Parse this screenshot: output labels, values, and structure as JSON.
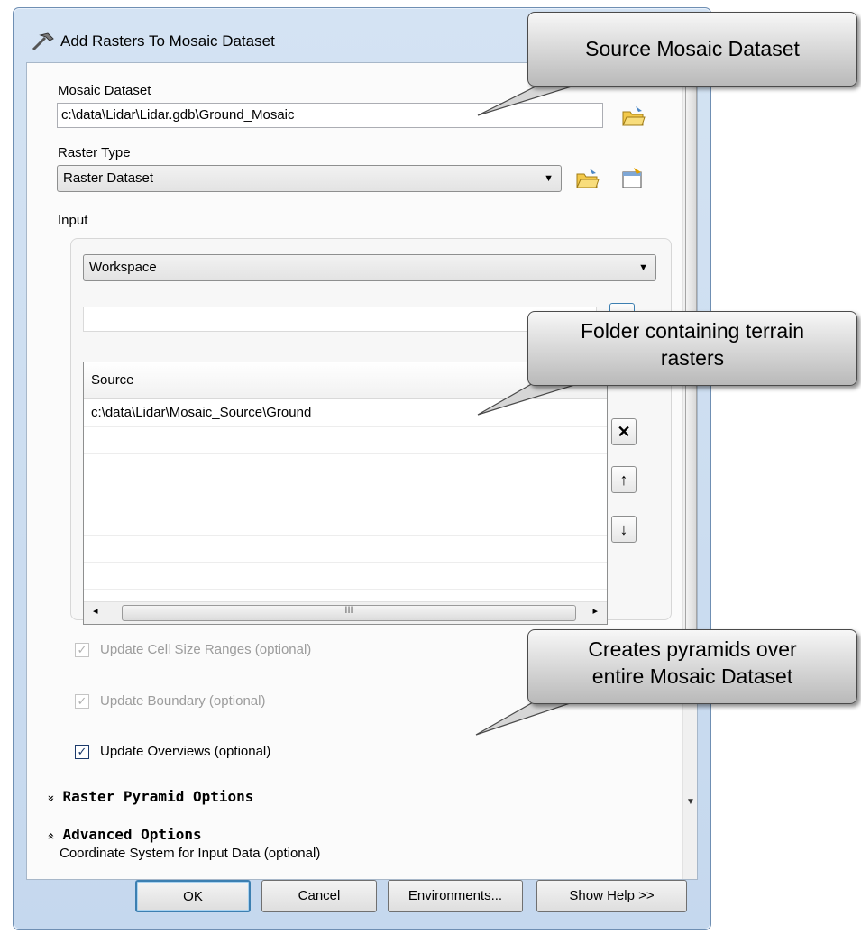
{
  "window": {
    "title": "Add Rasters To Mosaic Dataset"
  },
  "mosaic_dataset": {
    "label": "Mosaic Dataset",
    "value": "c:\\data\\Lidar\\Lidar.gdb\\Ground_Mosaic"
  },
  "raster_type": {
    "label": "Raster Type",
    "value": "Raster Dataset"
  },
  "input": {
    "label": "Input",
    "type_value": "Workspace",
    "path_value": "",
    "grid": {
      "header": "Source",
      "rows": [
        "c:\\data\\Lidar\\Mosaic_Source\\Ground"
      ]
    },
    "scroll_marker": "III"
  },
  "options": {
    "update_cell_size": {
      "label": "Update Cell Size Ranges (optional)",
      "checked": true,
      "enabled": false
    },
    "update_boundary": {
      "label": "Update Boundary (optional)",
      "checked": true,
      "enabled": false
    },
    "update_overviews": {
      "label": "Update Overviews (optional)",
      "checked": true,
      "enabled": true
    }
  },
  "sections": {
    "raster_pyramid": {
      "glyph": "»",
      "label": "Raster Pyramid Options"
    },
    "advanced": {
      "glyph": "«",
      "label": "Advanced Options",
      "field_label": "Coordinate System for Input Data (optional)"
    }
  },
  "buttons": {
    "ok": "OK",
    "cancel": "Cancel",
    "environments": "Environments...",
    "help": "Show Help >>"
  },
  "side_buttons": {
    "remove": "✕",
    "up": "↑",
    "down": "↓"
  },
  "callouts": {
    "source": "Source Mosaic Dataset",
    "folder_line1": "Folder containing terrain",
    "folder_line2": "rasters",
    "pyramids_line1": "Creates pyramids over",
    "pyramids_line2": "entire Mosaic Dataset"
  },
  "icons": [
    "hammer-icon",
    "open-folder-icon",
    "properties-icon",
    "dropdown-arrow-icon",
    "remove-icon",
    "move-up-icon",
    "move-down-icon"
  ]
}
